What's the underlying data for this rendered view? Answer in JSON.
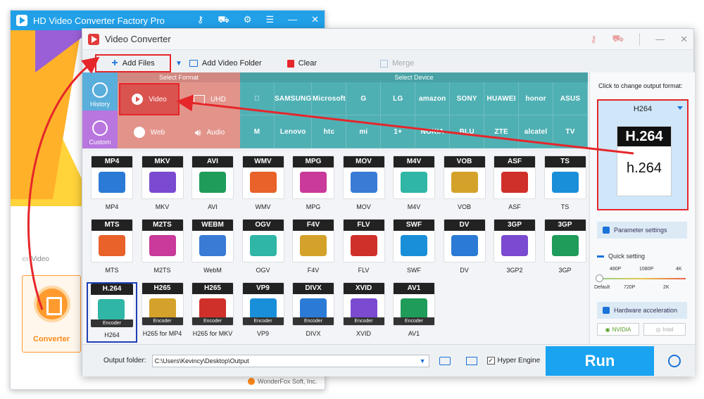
{
  "back_window": {
    "title": "HD Video Converter Factory Pro",
    "section_label": "Video",
    "converter_label": "Converter",
    "brand": "WonderFox Soft, Inc."
  },
  "window": {
    "title": "Video Converter"
  },
  "toolbar": {
    "add_files": "Add Files",
    "add_folder": "Add Video Folder",
    "clear": "Clear",
    "merge": "Merge"
  },
  "categories": {
    "select_format": "Select Format",
    "select_device": "Select Device",
    "history": "History",
    "custom": "Custom",
    "video": "Video",
    "uhd": "UHD",
    "web": "Web",
    "audio": "Audio"
  },
  "devices": [
    "",
    "SAMSUNG",
    "Microsoft",
    "G",
    "LG",
    "amazon",
    "SONY",
    "HUAWEI",
    "honor",
    "ASUS",
    "M",
    "Lenovo",
    "htc",
    "mi",
    "1+",
    "NOKIA",
    "BLU",
    "ZTE",
    "alcatel",
    "TV"
  ],
  "formats": {
    "row1": [
      "MP4",
      "MKV",
      "AVI",
      "WMV",
      "MPG",
      "MOV",
      "M4V",
      "VOB",
      "ASF",
      "TS"
    ],
    "row2": [
      "MTS",
      "M2TS",
      "WebM",
      "OGV",
      "F4V",
      "FLV",
      "SWF",
      "DV",
      "3GP2",
      "3GP"
    ],
    "row2_headers": [
      "MTS",
      "M2TS",
      "WEBM",
      "OGV",
      "F4V",
      "FLV",
      "SWF",
      "DV",
      "3GP",
      "3GP"
    ],
    "row3": [
      "H264",
      "H265 for MP4",
      "H265 for MKV",
      "VP9",
      "DIVX",
      "XVID",
      "AV1"
    ],
    "row3_headers": [
      "H.264",
      "H265",
      "H265",
      "VP9",
      "DIVX",
      "XVID",
      "AV1"
    ],
    "encoder_label": "Encoder"
  },
  "bottom": {
    "output_label": "Output folder:",
    "output_path": "C:\\Users\\Kevincy\\Desktop\\Output",
    "hyper_engine": "Hyper Engine",
    "run": "Run"
  },
  "right_panel": {
    "title": "Click to change output format:",
    "selected_format": "H264",
    "icon_top": "H.264",
    "icon_bottom": "h.264",
    "parameter_settings": "Parameter settings",
    "quick_setting": "Quick setting",
    "ticks_top": [
      "480P",
      "1080P",
      "4K"
    ],
    "ticks_bottom": [
      "Default",
      "720P",
      "2K"
    ],
    "hardware_acceleration": "Hardware acceleration",
    "nvidia": "NVIDIA",
    "intel": "Intel"
  },
  "colors": {
    "annotation": "#e5262a",
    "run": "#1aa3f0",
    "device_band": "#4fb0b4",
    "format_band": "#e2948b"
  }
}
